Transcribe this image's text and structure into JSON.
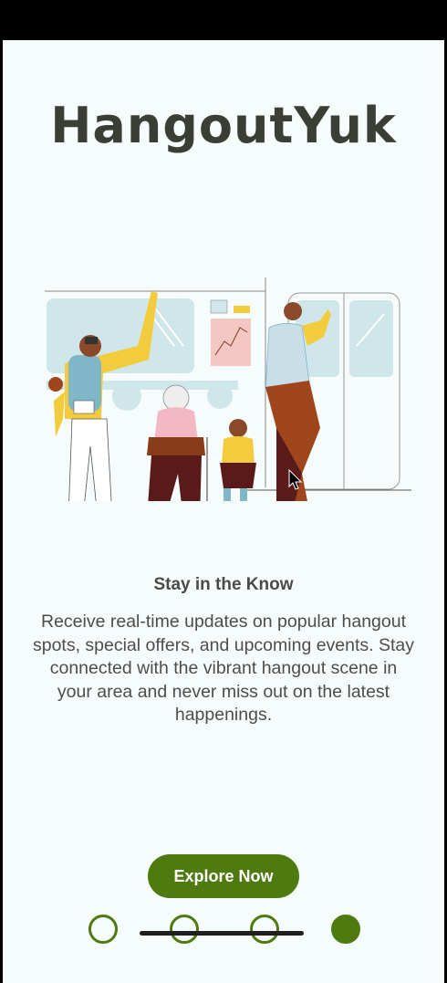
{
  "app": {
    "logo_text": "HangoutYuk"
  },
  "onboarding": {
    "title": "Stay in the Know",
    "description": "Receive real-time updates on popular hangout spots, special offers, and upcoming events. Stay connected with the vibrant hangout scene in your area and never miss out on the latest happenings.",
    "cta_label": "Explore Now",
    "illustration_icon": "people-on-train-illustration",
    "page_indicator": {
      "total": 4,
      "current": 4
    }
  },
  "colors": {
    "brand_green": "#4f7a10",
    "logo_dark": "#3a3f35",
    "background": "#f6fbfb"
  }
}
